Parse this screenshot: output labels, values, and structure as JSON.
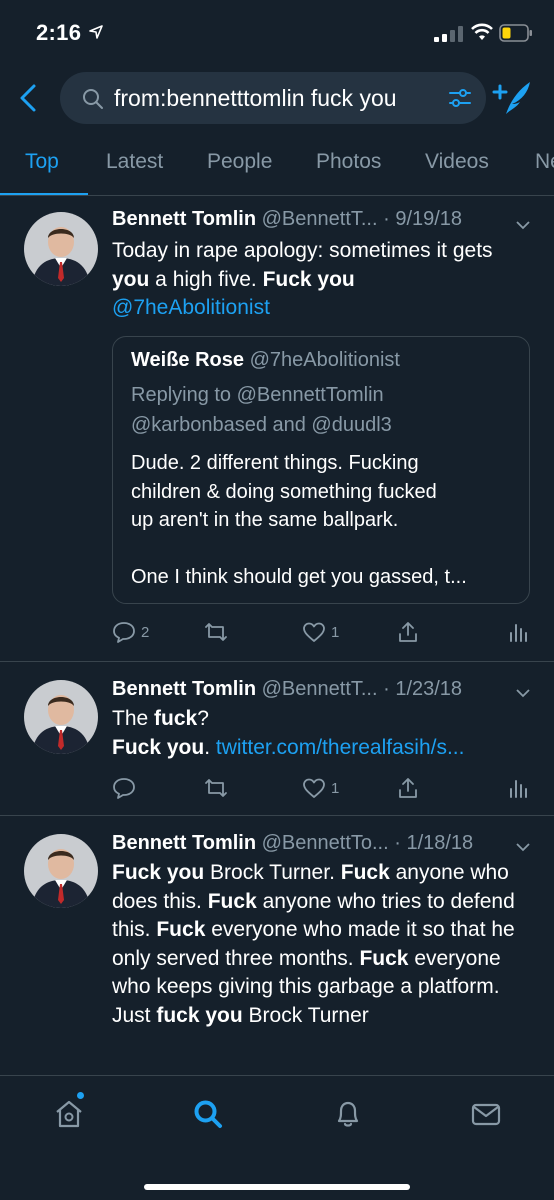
{
  "status_bar": {
    "time": "2:16"
  },
  "search": {
    "query": "from:bennetttomlin fuck you"
  },
  "tabs": [
    {
      "label": "Top",
      "active": true
    },
    {
      "label": "Latest"
    },
    {
      "label": "People"
    },
    {
      "label": "Photos"
    },
    {
      "label": "Videos"
    },
    {
      "label": "Ne"
    }
  ],
  "tweets": [
    {
      "name": "Bennett Tomlin",
      "handle": "@BennettT...",
      "date": "· 9/19/18",
      "body": [
        {
          "t": "Today in rape apology: sometimes it gets "
        },
        {
          "t": "you",
          "b": true
        },
        {
          "t": " a high five. "
        },
        {
          "t": "Fuck you",
          "b": true
        },
        {
          "t": " "
        },
        {
          "t": "@7heAbolitionist",
          "link": true
        }
      ],
      "quote": {
        "name": "Weiße Rose",
        "handle": "@7heAbolitionist",
        "replying": "Replying to @BennettTomlin",
        "replying_line2": "@karbonbased and @duudl3",
        "body_lines": [
          "Dude.   2 different things.   Fucking",
          "children & doing something fucked",
          "up aren't in the same ballpark.",
          "",
          "One I think should get you gassed, t..."
        ]
      },
      "reply_count": "2",
      "like_count": "1"
    },
    {
      "name": "Bennett Tomlin",
      "handle": "@BennettT...",
      "date": "· 1/23/18",
      "body_line1": [
        {
          "t": "The "
        },
        {
          "t": "fuck",
          "b": true
        },
        {
          "t": "?"
        }
      ],
      "body_line2": [
        {
          "t": "Fuck you",
          "b": true
        },
        {
          "t": ". "
        },
        {
          "t": "twitter.com/therealfasih/s...",
          "link": true
        }
      ],
      "reply_count": "",
      "like_count": "1"
    },
    {
      "name": "Bennett Tomlin",
      "handle": "@BennettTo...",
      "date": "· 1/18/18",
      "body": [
        {
          "t": "Fuck you",
          "b": true
        },
        {
          "t": " Brock Turner. "
        },
        {
          "t": "Fuck",
          "b": true
        },
        {
          "t": " anyone who does this. "
        },
        {
          "t": "Fuck",
          "b": true
        },
        {
          "t": " anyone who tries to defend this. "
        },
        {
          "t": "Fuck",
          "b": true
        },
        {
          "t": " everyone who made it so that he only served three months. "
        },
        {
          "t": "Fuck",
          "b": true
        },
        {
          "t": " everyone who keeps giving this garbage a platform. Just "
        },
        {
          "t": "fuck you",
          "b": true
        },
        {
          "t": " Brock Turner"
        }
      ]
    }
  ],
  "colors": {
    "accent": "#1da1f2",
    "background": "#15202b",
    "muted": "#8899a6",
    "border": "#38444d"
  }
}
